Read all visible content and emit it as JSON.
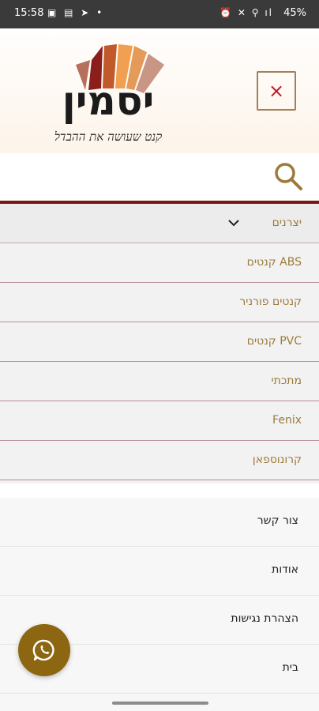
{
  "status_bar": {
    "time": "15:58",
    "battery": "45%",
    "left_icons": [
      "gallery-icon",
      "notification-icon",
      "telegram-icon",
      "dot-icon"
    ],
    "right_icons": [
      "alarm-icon",
      "mute-icon",
      "wifi-icon",
      "signal-icon",
      "battery-icon"
    ]
  },
  "header": {
    "logo_text": "יסמין",
    "logo_tagline": "קנט שעושה את ההבדל",
    "close_symbol": "×"
  },
  "colors": {
    "accent_gold": "#9b7b3a",
    "divider_red": "#7a1712",
    "close_red": "#b71d2b",
    "fab_brown": "#8c6610"
  },
  "submenu": {
    "title": "יצרנים",
    "items": [
      "ABS קנטים",
      "קנטים פורניר",
      "PVC קנטים",
      "מתכתי",
      "Fenix",
      "קרונוספאן"
    ]
  },
  "menu": {
    "items": [
      "צור קשר",
      "אודות",
      "הצהרת נגישות",
      "בית"
    ]
  }
}
